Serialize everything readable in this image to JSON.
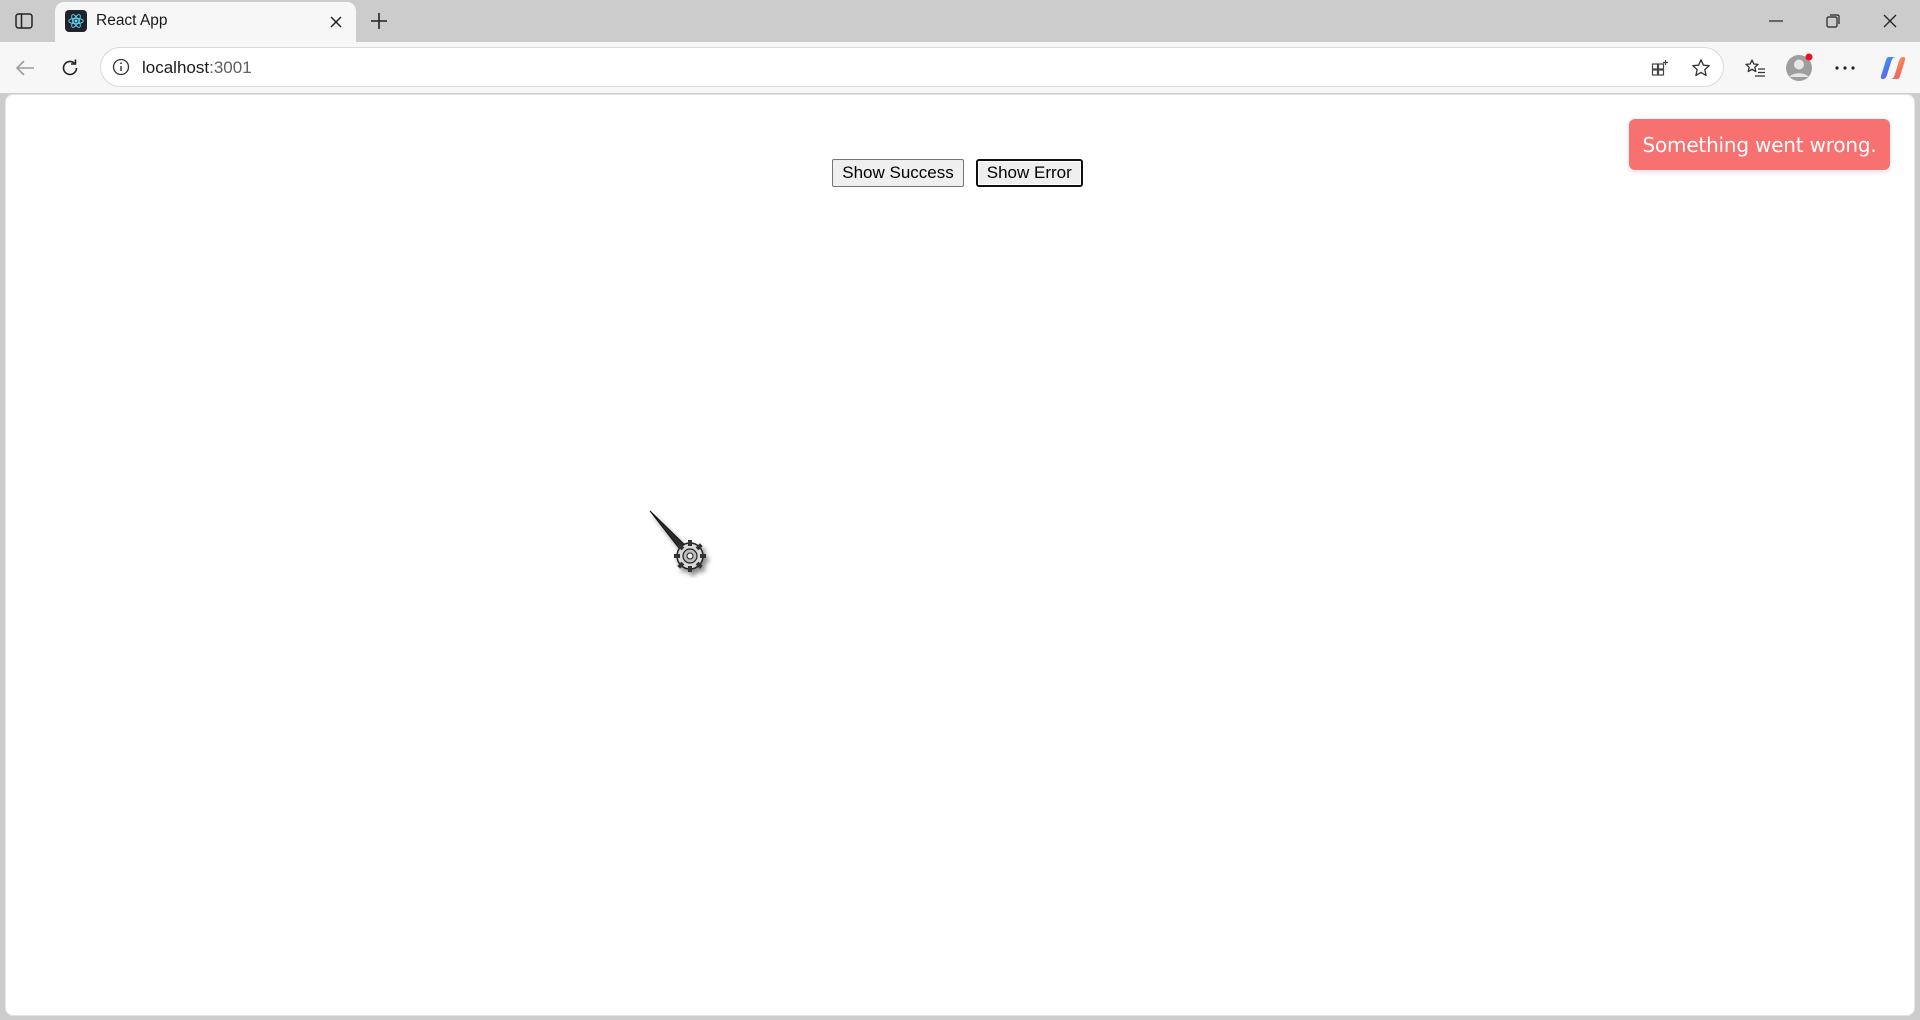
{
  "browser": {
    "tab": {
      "title": "React App",
      "favicon": "react-logo-icon"
    },
    "address": {
      "host": "localhost",
      "port": ":3001"
    },
    "icons": {
      "sidebar": "sidebar-toggle-icon",
      "close_tab": "close-icon",
      "new_tab": "plus-icon",
      "minimize": "minimize-icon",
      "restore": "restore-icon",
      "close_window": "close-icon",
      "back": "back-arrow-icon",
      "refresh": "refresh-icon",
      "site_info": "info-icon",
      "app_available": "app-grid-icon",
      "favorite": "star-icon",
      "favorites": "favorites-list-icon",
      "profile": "profile-avatar-icon",
      "more": "more-horizontal-icon",
      "copilot": "copilot-icon"
    }
  },
  "page": {
    "buttons": {
      "success_label": "Show Success",
      "error_label": "Show Error"
    },
    "toast": {
      "message": "Something went wrong.",
      "color": "#f87171"
    }
  },
  "cursor": "busy-cursor-icon"
}
